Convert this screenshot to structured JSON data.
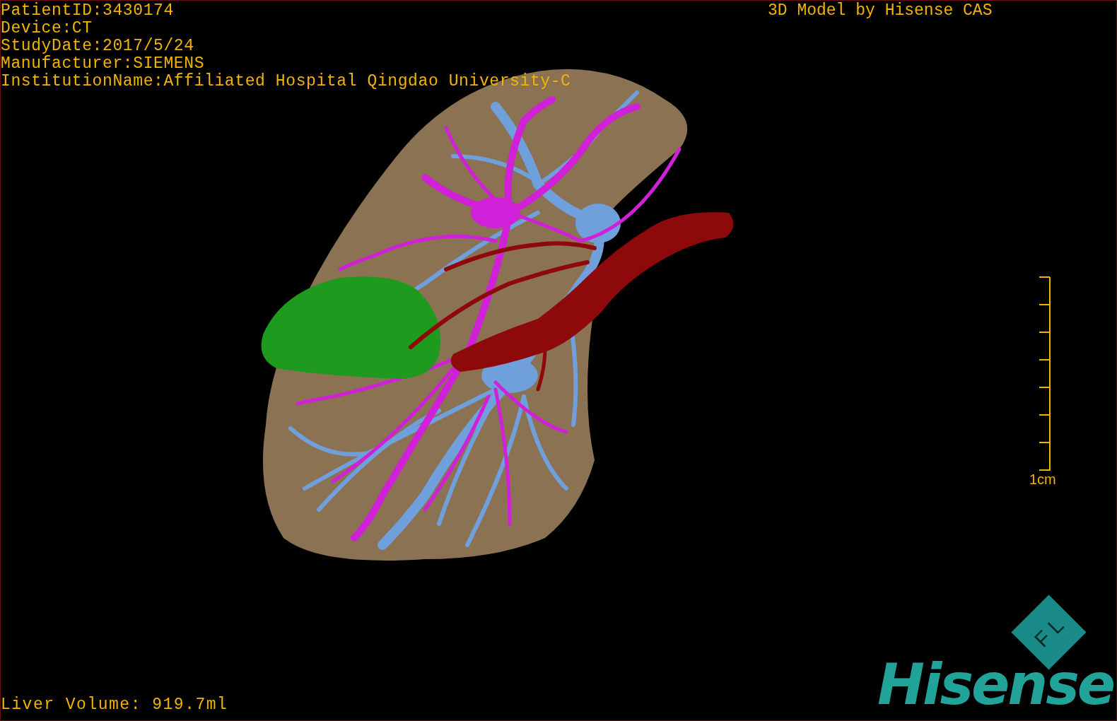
{
  "patient_info": [
    "PatientID:3430174",
    "Device:CT",
    "StudyDate:2017/5/24",
    "Manufacturer:SIEMENS",
    "InstitutionName:Affiliated Hospital Qingdao University-C"
  ],
  "credit": "3D Model by Hisense CAS",
  "scale_bar": {
    "label": "1cm"
  },
  "liver_volume": "Liver Volume: 919.7ml",
  "logo": {
    "badge": "F L",
    "wordmark": "Hisense"
  }
}
